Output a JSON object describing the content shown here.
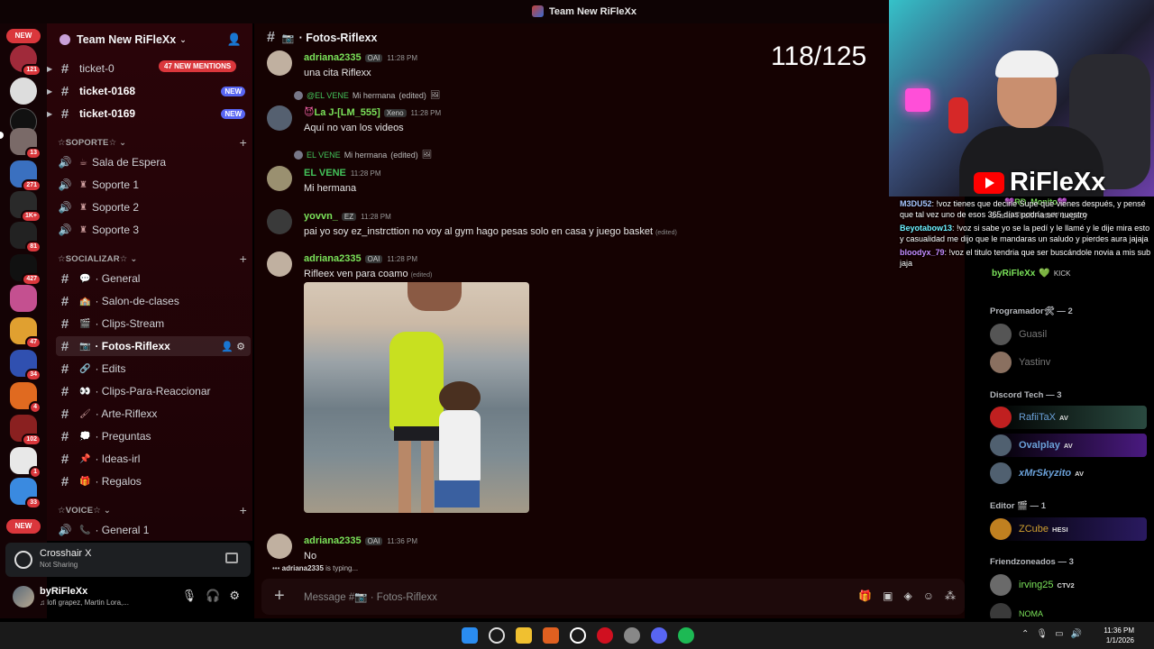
{
  "window": {
    "title": "Team New RiFleXx"
  },
  "rail": {
    "top_new": "NEW",
    "bottom_new": "NEW",
    "badges": [
      "121",
      "13",
      "271",
      "1K+",
      "81",
      "427",
      "47",
      "34",
      "4",
      "102",
      "1",
      "33"
    ]
  },
  "server": {
    "name": "Team New RiFleXx"
  },
  "mentions_pill": "47 NEW MENTIONS",
  "tickets": [
    {
      "label": "ticket-0",
      "new": ""
    },
    {
      "label": "ticket-0168",
      "new": "NEW"
    },
    {
      "label": "ticket-0169",
      "new": "NEW"
    }
  ],
  "categories": {
    "soporte": "☆SOPORTE☆",
    "socializar": "☆SOCIALIZAR☆",
    "voice": "☆VOICE☆"
  },
  "voice_soporte": [
    "Sala de Espera",
    "Soporte 1",
    "Soporte 2",
    "Soporte 3"
  ],
  "channels": [
    "· General",
    "· Salon-de-clases",
    "· Clips-Stream",
    "· Fotos-Riflexx",
    "· Edits",
    "· Clips-Para-Reaccionar",
    "· Arte-Riflexx",
    "· Preguntas",
    "· Ideas-irl",
    "· Regalos"
  ],
  "voice_general": "· General 1",
  "crosshair": {
    "name": "Crosshair X",
    "status": "Not Sharing"
  },
  "user": {
    "name": "byRiFleXx",
    "status": "♫ lofi grapez, Martin Lora,..."
  },
  "chat": {
    "channel": "· Fotos-Riflexx",
    "counter": "118/125",
    "messages": [
      {
        "user": "adriana2335",
        "tag": "OAI",
        "time": "11:28 PM",
        "text": "una cita Riflexx"
      },
      {
        "reply_user": "@EL VENE",
        "reply_text": "Mi hermana",
        "reply_edited": "(edited)",
        "user": "La J-[LM_555]",
        "tag": "Xeno",
        "time": "11:28 PM",
        "text": "Aquí no van los videos"
      },
      {
        "reply_user": "EL VENE",
        "reply_text": "Mi hermana",
        "reply_edited": "(edited)",
        "user": "EL VENE",
        "tag": "",
        "time": "11:28 PM",
        "text": "Mi hermana"
      },
      {
        "user": "yovvn_",
        "tag": "EZ",
        "time": "11:28 PM",
        "text": "pai yo soy ez_instrcttion no voy al gym hago pesas solo en casa y juego basket",
        "edited": "(edited)"
      },
      {
        "user": "adriana2335",
        "tag": "OAI",
        "time": "11:28 PM",
        "text": "Rifleex ven para coamo",
        "edited": "(edited)"
      },
      {
        "user": "adriana2335",
        "tag": "OAI",
        "time": "11:36 PM",
        "text": "No"
      }
    ],
    "typing_user": "adriana2335",
    "typing_text": " is typing...",
    "composer_placeholder": "Message #📷 · Fotos-Riflexx"
  },
  "stream": {
    "brand": "RiFleXx",
    "overlay_lines": [
      {
        "user": "M3DU52",
        "text": ": !voz tienes que decirle Supe que vienes después, y pensé que tal vez uno de esos 365 días podría ser nuestro"
      },
      {
        "user": "Beyotabow13",
        "text": ": !voz si sabe yo se la pedí y le llamé y le dije mira esto y casualidad me dijo que le mandaras un saludo y pierdes aura jajaja"
      },
      {
        "user": "bloodyx_79",
        "text": ": !voz el titulo tendria que ser buscándole novia a mis sub jaja"
      }
    ],
    "rd_monito": "RD_Monito",
    "gta": "Grand Theft Auto V Legacy",
    "byr_name": "byRiFleXx",
    "byr_kick": "KICK"
  },
  "members": {
    "groups": [
      {
        "title": "Programador🛠 — 2",
        "items": [
          {
            "name": "Guasil",
            "badge": ""
          },
          {
            "name": "Yastinv",
            "badge": ""
          }
        ]
      },
      {
        "title": "Discord Tech — 3",
        "items": [
          {
            "name": "RafiiTaX",
            "badge": "AV"
          },
          {
            "name": "Ovalplay",
            "badge": "AV"
          },
          {
            "name": "xMrSkyzito",
            "badge": "AV"
          }
        ]
      },
      {
        "title": "Editor 🎬 — 1",
        "items": [
          {
            "name": "ZCube",
            "badge": "HESI"
          }
        ]
      },
      {
        "title": "Friendzoneados — 3",
        "items": [
          {
            "name": "irving25",
            "badge": "CTV2"
          },
          {
            "name": "NOMA",
            "badge": ""
          }
        ]
      }
    ]
  },
  "taskbar": {
    "time": "11:36 PM",
    "date": "1/1/2026"
  }
}
